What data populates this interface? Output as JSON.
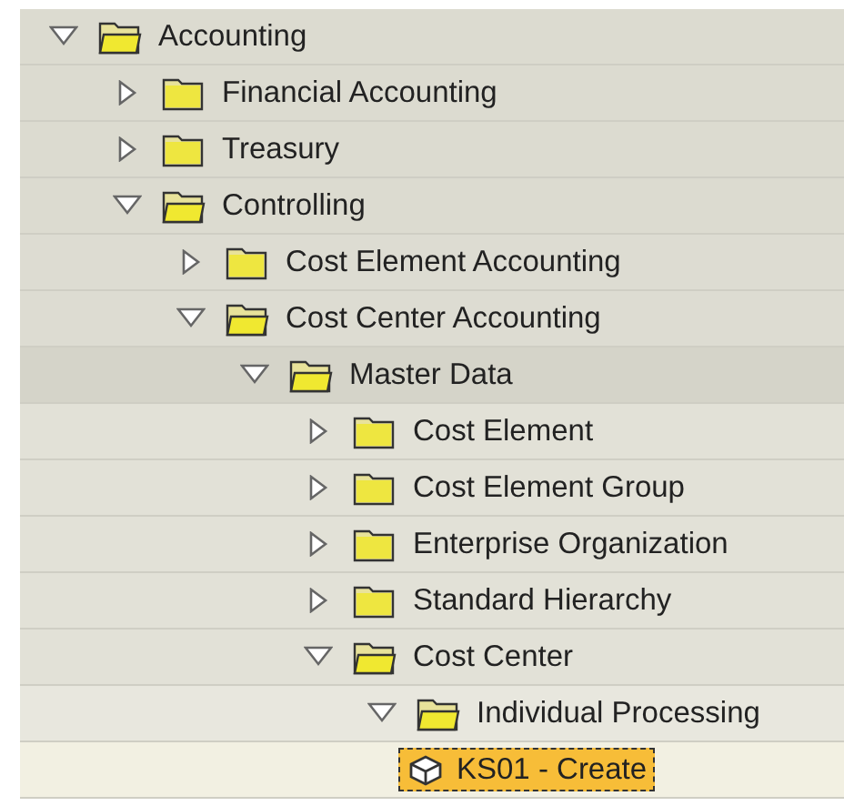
{
  "tree": [
    {
      "label": "Accounting",
      "kind": "folder",
      "expanded": true,
      "children": [
        {
          "label": "Financial Accounting",
          "kind": "folder",
          "expanded": false
        },
        {
          "label": "Treasury",
          "kind": "folder",
          "expanded": false
        },
        {
          "label": "Controlling",
          "kind": "folder",
          "expanded": true,
          "children": [
            {
              "label": "Cost Element Accounting",
              "kind": "folder",
              "expanded": false
            },
            {
              "label": "Cost Center Accounting",
              "kind": "folder",
              "expanded": true,
              "children": [
                {
                  "label": "Master Data",
                  "kind": "folder",
                  "expanded": true,
                  "children": [
                    {
                      "label": "Cost Element",
                      "kind": "folder",
                      "expanded": false
                    },
                    {
                      "label": "Cost Element Group",
                      "kind": "folder",
                      "expanded": false
                    },
                    {
                      "label": "Enterprise Organization",
                      "kind": "folder",
                      "expanded": false
                    },
                    {
                      "label": "Standard Hierarchy",
                      "kind": "folder",
                      "expanded": false
                    },
                    {
                      "label": "Cost Center",
                      "kind": "folder",
                      "expanded": true,
                      "children": [
                        {
                          "label": "Individual Processing",
                          "kind": "folder",
                          "expanded": true,
                          "children": [
                            {
                              "label": "KS01 - Create",
                              "kind": "transaction",
                              "selected": true
                            }
                          ]
                        }
                      ]
                    }
                  ]
                }
              ]
            }
          ]
        }
      ]
    }
  ]
}
